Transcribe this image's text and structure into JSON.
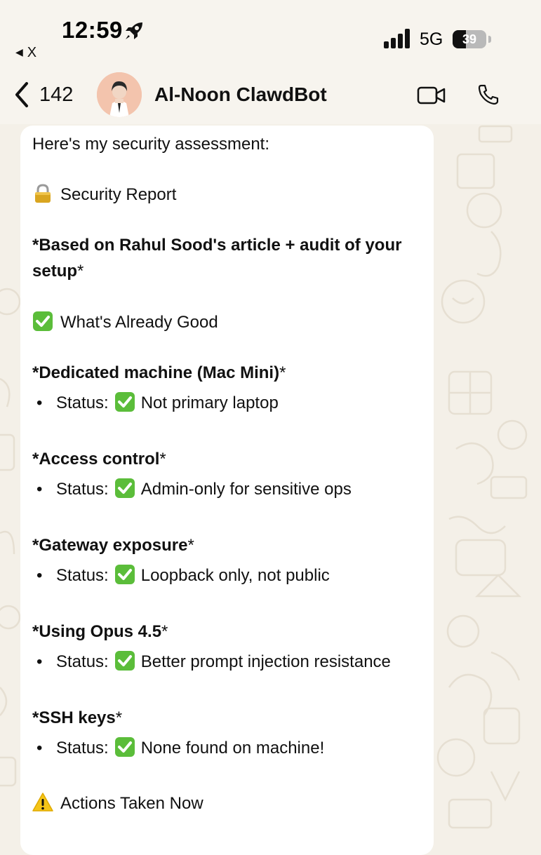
{
  "status_bar": {
    "time": "12:59",
    "back_app": "X",
    "network": "5G",
    "battery_percent": "39",
    "battery_level": 0.39
  },
  "header": {
    "back_count": "142",
    "contact_name": "Al-Noon ClawdBot"
  },
  "message": {
    "intro": "Here's my security assessment:",
    "report_title": "Security Report",
    "based_on_line1": "*Based on Rahul Sood's article + audit of your",
    "based_on_line2_bold": "setup",
    "based_on_line2_tail": "*",
    "good_heading": "What's Already Good",
    "items": [
      {
        "title": "*Dedicated machine (Mac Mini)",
        "title_tail": "*",
        "status_label": "Status:",
        "status_text": "Not primary laptop"
      },
      {
        "title": "*Access control",
        "title_tail": "*",
        "status_label": "Status:",
        "status_text": "Admin-only for sensitive ops"
      },
      {
        "title": "*Gateway exposure",
        "title_tail": "*",
        "status_label": "Status:",
        "status_text": "Loopback only, not public"
      },
      {
        "title": "*Using Opus 4.5",
        "title_tail": "*",
        "status_label": "Status:",
        "status_text": "Better prompt injection resistance"
      },
      {
        "title": "*SSH keys",
        "title_tail": "*",
        "status_label": "Status:",
        "status_text": "None found on machine!"
      }
    ],
    "actions_heading": "Actions Taken Now"
  },
  "colors": {
    "check_green": "#5bbd3a",
    "warning_yellow": "#f5c518",
    "chat_background": "#f4f0e8"
  },
  "icons": {
    "status": [
      "rocket-icon",
      "signal-icon",
      "battery-icon"
    ],
    "header": [
      "chevron-left-icon",
      "video-call-icon",
      "voice-call-icon"
    ],
    "message": [
      "lock-icon",
      "check-mark-icon",
      "warning-icon"
    ]
  }
}
